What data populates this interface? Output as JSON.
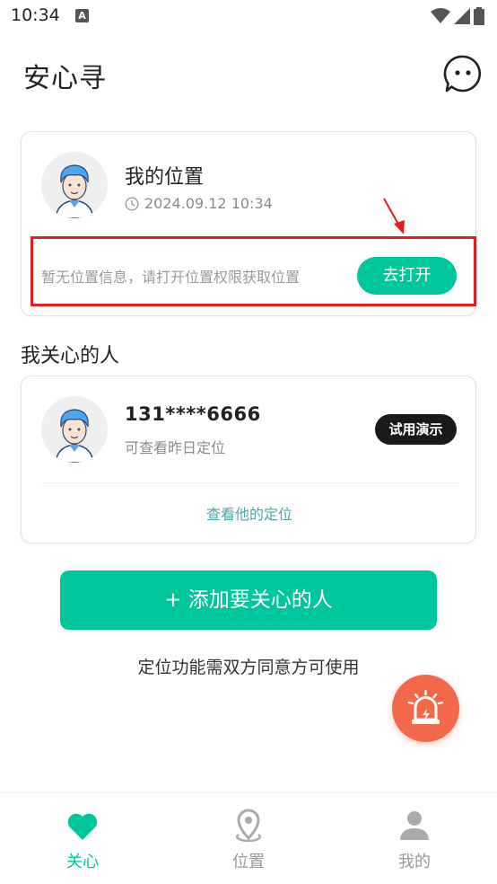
{
  "status_bar": {
    "time": "10:34",
    "notif_letter": "A"
  },
  "header": {
    "title": "安心寻"
  },
  "my_location": {
    "name": "我的位置",
    "timestamp": "2024.09.12 10:34",
    "notice": "暂无位置信息，请打开位置权限获取位置",
    "open_button": "去打开"
  },
  "care_section": {
    "title": "我关心的人",
    "person": {
      "phone": "131****6666",
      "subtitle": "可查看昨日定位",
      "badge": "试用演示",
      "link": "查看他的定位"
    }
  },
  "add_button": "+ 添加要关心的人",
  "hint": "定位功能需双方同意方可使用",
  "nav": {
    "items": [
      {
        "label": "关心",
        "icon": "heart-icon",
        "active": true
      },
      {
        "label": "位置",
        "icon": "location-pin-icon",
        "active": false
      },
      {
        "label": "我的",
        "icon": "person-icon",
        "active": false
      }
    ]
  },
  "colors": {
    "accent": "#00c79b",
    "warning": "#e02020",
    "sos": "#f2694a",
    "inactive": "#aaaaaa"
  }
}
